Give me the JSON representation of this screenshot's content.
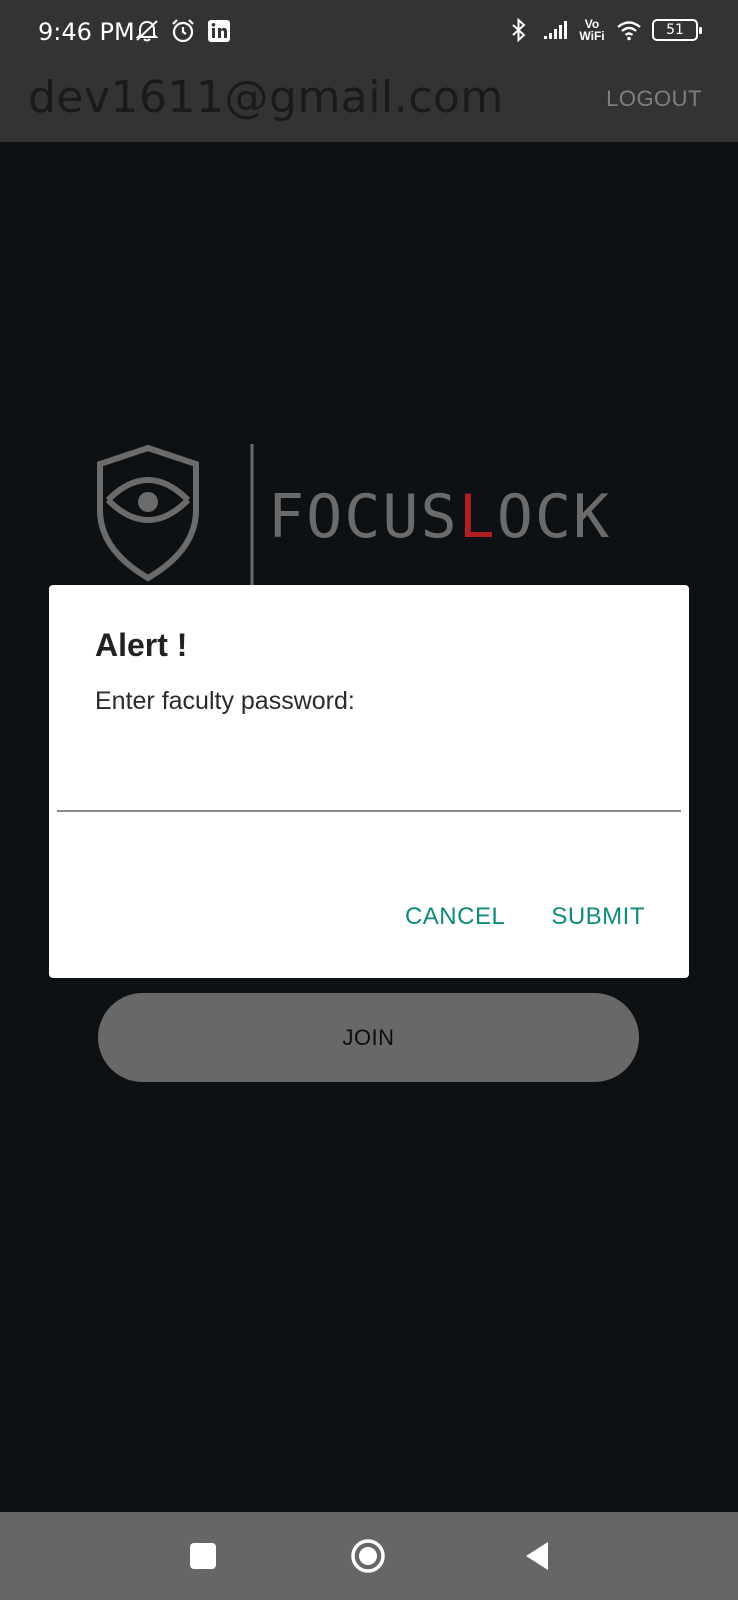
{
  "status_bar": {
    "time": "9:46 PM",
    "left_icons": [
      "notifications-muted-icon",
      "alarm-icon",
      "linkedin-icon"
    ],
    "right_icons": [
      "bluetooth-icon",
      "signal-icon",
      "vowifi-icon",
      "wifi-icon",
      "battery-icon"
    ],
    "vowifi_top": "Vo",
    "vowifi_bottom": "WiFi",
    "battery_level": "51"
  },
  "app_bar": {
    "email": "dev1611@gmail.com",
    "logout_label": "LOGOUT"
  },
  "logo": {
    "text_part1": "FOCUS",
    "text_highlight": "L",
    "text_part2": "OCK",
    "accent_color": "#b02020",
    "text_color": "#6b6b6b"
  },
  "join_button": {
    "label": "JOIN"
  },
  "dialog": {
    "title": "Alert !",
    "message": "Enter faculty password:",
    "input_value": "",
    "cancel_label": "CANCEL",
    "submit_label": "SUBMIT",
    "accent_color": "#0f8a7b"
  },
  "nav_bar": {
    "buttons": [
      "recents-icon",
      "home-icon",
      "back-icon"
    ]
  }
}
